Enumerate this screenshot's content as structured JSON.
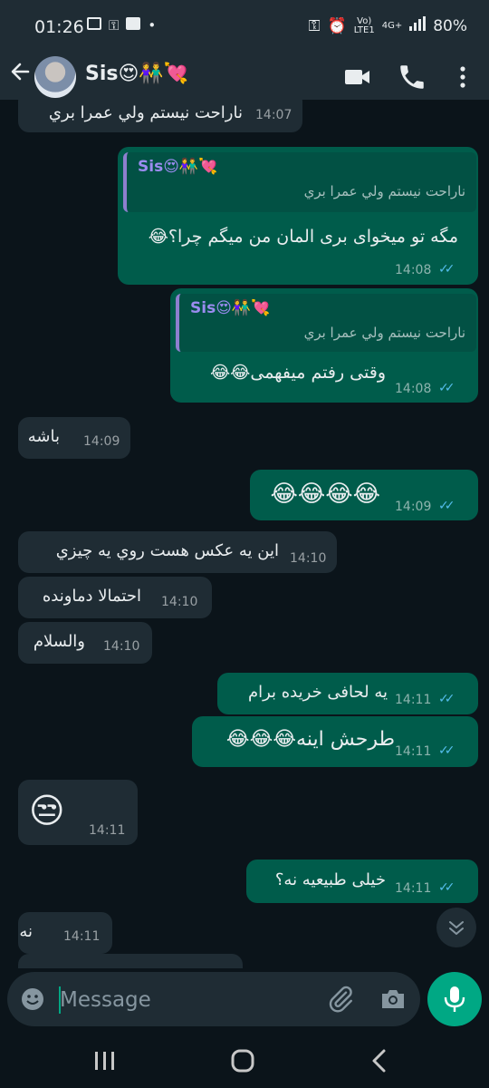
{
  "status": {
    "time": "01:26",
    "network": "4G+",
    "carrier": "LTE1",
    "battery": "80%"
  },
  "header": {
    "name": "Sis😍👫💘"
  },
  "messages": [
    {
      "dir": "in",
      "text": "ناراحت نيستم ولي عمرا بري",
      "time": "14:07"
    },
    {
      "dir": "out",
      "quote_name": "Sis😍👫💘",
      "quote_text": "ناراحت نيستم ولي عمرا بري",
      "text": "مگه تو میخوای بری المان من میگم چرا؟😂",
      "time": "14:08"
    },
    {
      "dir": "out",
      "quote_name": "Sis😍👫💘",
      "quote_text": "ناراحت نيستم ولي عمرا بري",
      "text": "وقتی رفتم میفهمی😂😂",
      "time": "14:08"
    },
    {
      "dir": "in",
      "text": "باشه",
      "time": "14:09"
    },
    {
      "dir": "out",
      "text": "😂😂😂😂",
      "time": "14:09"
    },
    {
      "dir": "in",
      "text": "اين يه عكس هست روي يه چيزي",
      "time": "14:10"
    },
    {
      "dir": "in",
      "text": "احتمالا دماونده",
      "time": "14:10"
    },
    {
      "dir": "in",
      "text": "والسلام",
      "time": "14:10"
    },
    {
      "dir": "out",
      "text": "یه لحافی خریده برام",
      "time": "14:11"
    },
    {
      "dir": "out",
      "text": "طرحش اینه😂😂😂",
      "time": "14:11"
    },
    {
      "dir": "in",
      "text": "😒",
      "time": "14:11"
    },
    {
      "dir": "out",
      "text": "خیلی طبیعیه نه؟",
      "time": "14:11"
    },
    {
      "dir": "in",
      "text": "نه",
      "time": "14:11"
    }
  ],
  "composer": {
    "placeholder": "Message"
  },
  "colors": {
    "incoming": "#1f2c34",
    "outgoing": "#005c4b",
    "accent": "#00a884",
    "tick": "#53bdeb"
  }
}
